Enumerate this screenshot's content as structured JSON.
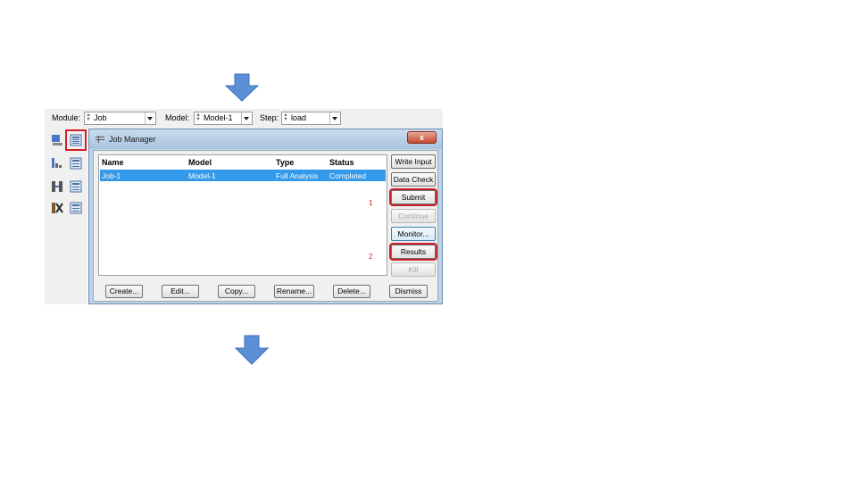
{
  "toolbar": {
    "module_label": "Module:",
    "module_value": "Job",
    "model_label": "Model:",
    "model_value": "Model-1",
    "step_label": "Step:",
    "step_value": "load"
  },
  "dialog": {
    "title": "Job Manager",
    "close_label": "x",
    "columns": [
      "Name",
      "Model",
      "Type",
      "Status"
    ],
    "rows": [
      {
        "name": "Job-1",
        "model": "Model-1",
        "type": "Full Analysis",
        "status": "Completed"
      }
    ],
    "side_buttons": {
      "write_input": "Write Input",
      "data_check": "Data Check",
      "submit": "Submit",
      "continue": "Continue",
      "monitor": "Monitor...",
      "results": "Results",
      "kill": "Kill"
    },
    "bottom_buttons": {
      "create": "Create...",
      "edit": "Edit...",
      "copy": "Copy...",
      "rename": "Rename...",
      "delete": "Delete...",
      "dismiss": "Dismiss"
    },
    "step_markers": {
      "first": "1",
      "second": "2"
    }
  },
  "colors": {
    "arrow": "#5b8fd6",
    "highlight": "#d0202a",
    "selection": "#3399e8"
  },
  "icons": [
    "down-arrow-icon",
    "job-manager-icon",
    "close-icon",
    "dropdown-icon"
  ]
}
